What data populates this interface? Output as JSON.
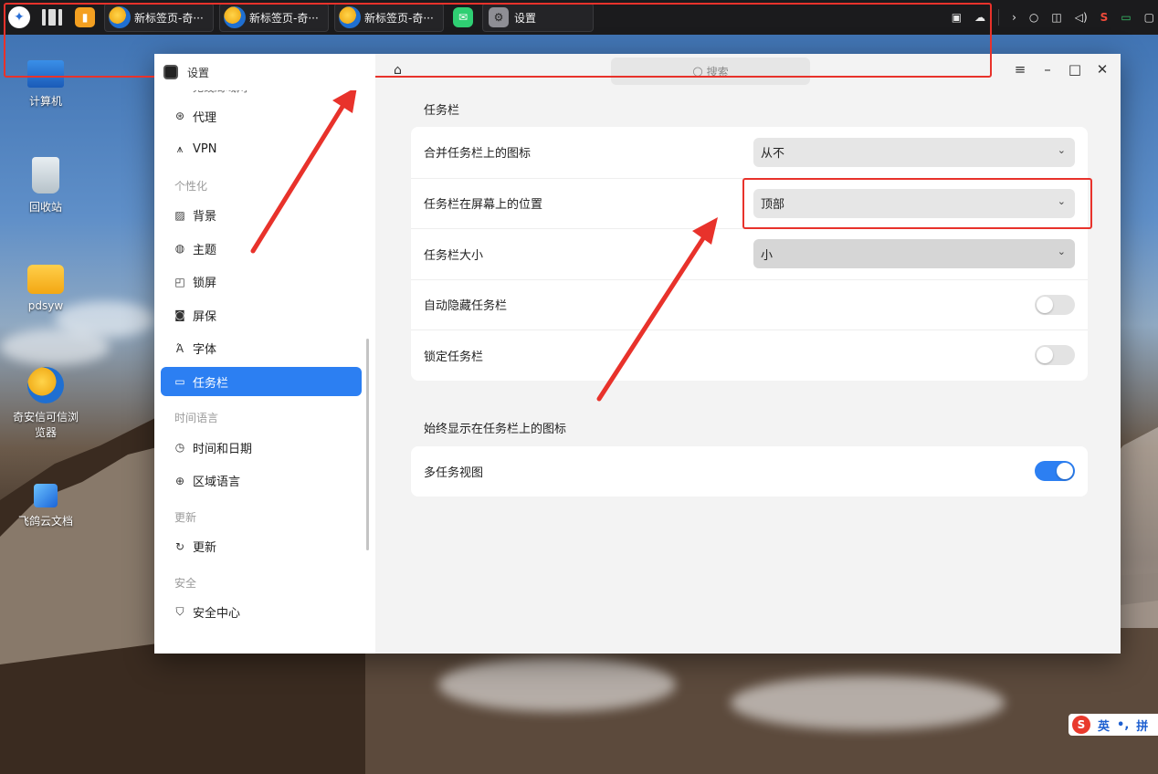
{
  "taskbar": {
    "apps": [
      {
        "label": "新标签页-奇···"
      },
      {
        "label": "新标签页-奇···"
      },
      {
        "label": "新标签页-奇···"
      }
    ],
    "settings_label": "设置"
  },
  "desktop": {
    "icons": [
      {
        "label": "计算机"
      },
      {
        "label": "回收站"
      },
      {
        "label": "pdsyw"
      },
      {
        "label": "奇安信可信浏览器"
      },
      {
        "label": "飞鸽云文档"
      }
    ]
  },
  "window": {
    "app_title": "设置",
    "search_placeholder": "搜索"
  },
  "sidebar": {
    "cut_item": "无线局域网",
    "items_top": [
      {
        "label": "代理"
      },
      {
        "label": "VPN"
      }
    ],
    "group_personal": "个性化",
    "items_personal": [
      {
        "label": "背景"
      },
      {
        "label": "主题"
      },
      {
        "label": "锁屏"
      },
      {
        "label": "屏保"
      },
      {
        "label": "字体"
      },
      {
        "label": "任务栏"
      }
    ],
    "group_time": "时间语言",
    "items_time": [
      {
        "label": "时间和日期"
      },
      {
        "label": "区域语言"
      }
    ],
    "group_update": "更新",
    "items_update": [
      {
        "label": "更新"
      }
    ],
    "group_security": "安全",
    "items_security": [
      {
        "label": "安全中心"
      }
    ],
    "active": "任务栏"
  },
  "main": {
    "section1_title": "任务栏",
    "rows": [
      {
        "label": "合并任务栏上的图标",
        "value": "从不"
      },
      {
        "label": "任务栏在屏幕上的位置",
        "value": "顶部"
      },
      {
        "label": "任务栏大小",
        "value": "小"
      },
      {
        "label": "自动隐藏任务栏",
        "toggle": false
      },
      {
        "label": "锁定任务栏",
        "toggle": false
      }
    ],
    "section2_title": "始终显示在任务栏上的图标",
    "rows2": [
      {
        "label": "多任务视图",
        "toggle": true
      }
    ]
  },
  "ime": {
    "lang": "英",
    "mode": "拼"
  },
  "colors": {
    "accent": "#2c7ff2",
    "annotation": "#e8322b"
  }
}
